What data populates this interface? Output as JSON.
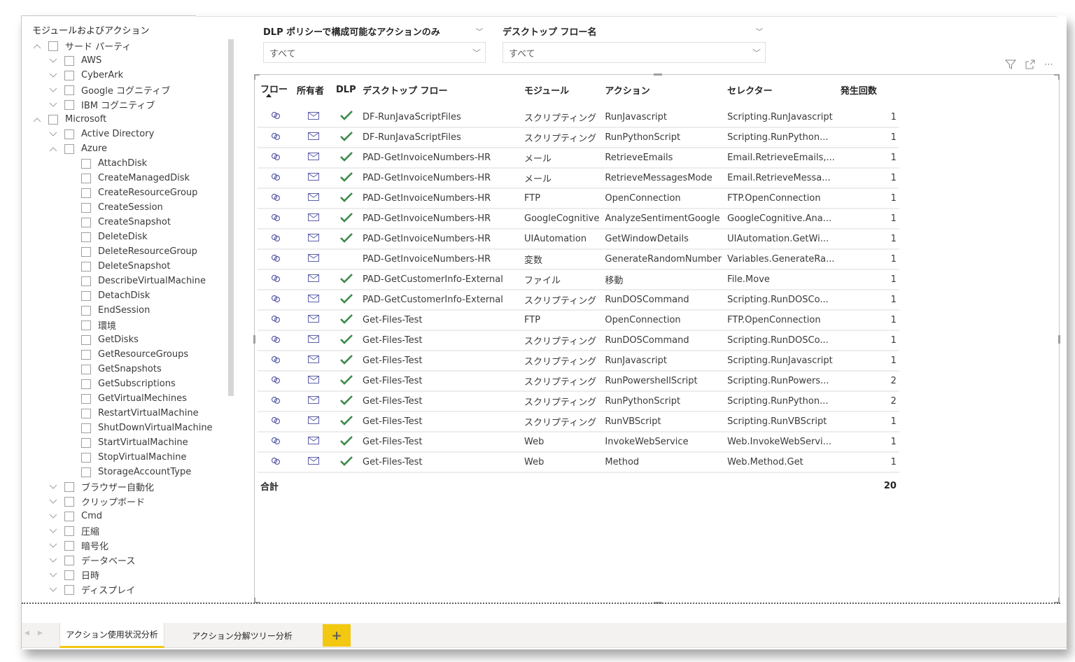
{
  "slicer": {
    "title": "モジュールおよびアクション",
    "items": [
      {
        "label": "サード パーティ",
        "level": 0,
        "expanded": true
      },
      {
        "label": "AWS",
        "level": 1,
        "expanded": false
      },
      {
        "label": "CyberArk",
        "level": 1,
        "expanded": false
      },
      {
        "label": "Google コグニティブ",
        "level": 1,
        "expanded": false
      },
      {
        "label": "IBM コグニティブ",
        "level": 1,
        "expanded": false
      },
      {
        "label": "Microsoft",
        "level": 0,
        "expanded": true
      },
      {
        "label": "Active Directory",
        "level": 1,
        "expanded": false
      },
      {
        "label": "Azure",
        "level": 1,
        "expanded": true
      },
      {
        "label": "AttachDisk",
        "level": 2
      },
      {
        "label": "CreateManagedDisk",
        "level": 2
      },
      {
        "label": "CreateResourceGroup",
        "level": 2
      },
      {
        "label": "CreateSession",
        "level": 2
      },
      {
        "label": "CreateSnapshot",
        "level": 2
      },
      {
        "label": "DeleteDisk",
        "level": 2
      },
      {
        "label": "DeleteResourceGroup",
        "level": 2
      },
      {
        "label": "DeleteSnapshot",
        "level": 2
      },
      {
        "label": "DescribeVirtualMachine",
        "level": 2
      },
      {
        "label": "DetachDisk",
        "level": 2
      },
      {
        "label": "EndSession",
        "level": 2
      },
      {
        "label": "環境",
        "level": 2
      },
      {
        "label": "GetDisks",
        "level": 2
      },
      {
        "label": "GetResourceGroups",
        "level": 2
      },
      {
        "label": "GetSnapshots",
        "level": 2
      },
      {
        "label": "GetSubscriptions",
        "level": 2
      },
      {
        "label": "GetVirtualMechines",
        "level": 2
      },
      {
        "label": "RestartVirtualMachine",
        "level": 2
      },
      {
        "label": "ShutDownVirtualMachine",
        "level": 2
      },
      {
        "label": "StartVirtualMachine",
        "level": 2
      },
      {
        "label": "StopVirtualMachine",
        "level": 2
      },
      {
        "label": "StorageAccountType",
        "level": 2
      },
      {
        "label": "ブラウザー自動化",
        "level": 1,
        "expanded": false
      },
      {
        "label": "クリップボード",
        "level": 1,
        "expanded": false
      },
      {
        "label": "Cmd",
        "level": 1,
        "expanded": false
      },
      {
        "label": "圧縮",
        "level": 1,
        "expanded": false
      },
      {
        "label": "暗号化",
        "level": 1,
        "expanded": false
      },
      {
        "label": "データベース",
        "level": 1,
        "expanded": false
      },
      {
        "label": "日時",
        "level": 1,
        "expanded": false
      },
      {
        "label": "ディスプレイ",
        "level": 1,
        "expanded": false
      }
    ]
  },
  "filters": {
    "dlp": {
      "title": "DLP ポリシーで構成可能なアクションのみ",
      "value": "すべて"
    },
    "flow": {
      "title": "デスクトップ フロー名",
      "value": "すべて"
    }
  },
  "visual_icons": {
    "filter": "filter-icon",
    "focus": "focus-mode-icon",
    "more": "more-options-icon"
  },
  "table": {
    "columns": [
      "フロー",
      "所有者",
      "DLP",
      "デスクトップ フロー",
      "モジュール",
      "アクション",
      "セレクター",
      "発生回数"
    ],
    "sorted_column": "フロー",
    "rows": [
      {
        "dlp": true,
        "flow": "DF-RunJavaScriptFiles",
        "module": "スクリプティング",
        "action": "RunJavascript",
        "selector": "Scripting.RunJavascript",
        "count": "1"
      },
      {
        "dlp": true,
        "flow": "DF-RunJavaScriptFiles",
        "module": "スクリプティング",
        "action": "RunPythonScript",
        "selector": "Scripting.RunPython...",
        "count": "1"
      },
      {
        "dlp": true,
        "flow": "PAD-GetInvoiceNumbers-HR",
        "module": "メール",
        "action": "RetrieveEmails",
        "selector": "Email.RetrieveEmails,...",
        "count": "1"
      },
      {
        "dlp": true,
        "flow": "PAD-GetInvoiceNumbers-HR",
        "module": "メール",
        "action": "RetrieveMessagesMode",
        "selector": "Email.RetrieveMessa...",
        "count": "1"
      },
      {
        "dlp": true,
        "flow": "PAD-GetInvoiceNumbers-HR",
        "module": "FTP",
        "action": "OpenConnection",
        "selector": "FTP.OpenConnection",
        "count": "1"
      },
      {
        "dlp": true,
        "flow": "PAD-GetInvoiceNumbers-HR",
        "module": "GoogleCognitive",
        "action": "AnalyzeSentimentGoogle",
        "selector": "GoogleCognitive.Ana...",
        "count": "1"
      },
      {
        "dlp": true,
        "flow": "PAD-GetInvoiceNumbers-HR",
        "module": "UIAutomation",
        "action": "GetWindowDetails",
        "selector": "UIAutomation.GetWi...",
        "count": "1"
      },
      {
        "dlp": false,
        "flow": "PAD-GetInvoiceNumbers-HR",
        "module": "変数",
        "action": "GenerateRandomNumber",
        "selector": "Variables.GenerateRa...",
        "count": "1"
      },
      {
        "dlp": true,
        "flow": "PAD-GetCustomerInfo-External",
        "module": "ファイル",
        "action": "移動",
        "selector": "File.Move",
        "count": "1"
      },
      {
        "dlp": true,
        "flow": "PAD-GetCustomerInfo-External",
        "module": "スクリプティング",
        "action": "RunDOSCommand",
        "selector": "Scripting.RunDOSCo...",
        "count": "1"
      },
      {
        "dlp": true,
        "flow": "Get-Files-Test",
        "module": "FTP",
        "action": "OpenConnection",
        "selector": "FTP.OpenConnection",
        "count": "1"
      },
      {
        "dlp": true,
        "flow": "Get-Files-Test",
        "module": "スクリプティング",
        "action": "RunDOSCommand",
        "selector": "Scripting.RunDOSCo...",
        "count": "1"
      },
      {
        "dlp": true,
        "flow": "Get-Files-Test",
        "module": "スクリプティング",
        "action": "RunJavascript",
        "selector": "Scripting.RunJavascript",
        "count": "1"
      },
      {
        "dlp": true,
        "flow": "Get-Files-Test",
        "module": "スクリプティング",
        "action": "RunPowershellScript",
        "selector": "Scripting.RunPowers...",
        "count": "2"
      },
      {
        "dlp": true,
        "flow": "Get-Files-Test",
        "module": "スクリプティング",
        "action": "RunPythonScript",
        "selector": "Scripting.RunPython...",
        "count": "2"
      },
      {
        "dlp": true,
        "flow": "Get-Files-Test",
        "module": "スクリプティング",
        "action": "RunVBScript",
        "selector": "Scripting.RunVBScript",
        "count": "1"
      },
      {
        "dlp": true,
        "flow": "Get-Files-Test",
        "module": "Web",
        "action": "InvokeWebService",
        "selector": "Web.InvokeWebServi...",
        "count": "1"
      },
      {
        "dlp": true,
        "flow": "Get-Files-Test",
        "module": "Web",
        "action": "Method",
        "selector": "Web.Method.Get",
        "count": "1"
      }
    ],
    "total_label": "合計",
    "total_value": "20"
  },
  "tabs": {
    "items": [
      "アクション使用状況分析",
      "アクション分解ツリー分析"
    ],
    "active": 0,
    "add_label": "+"
  },
  "colors": {
    "accent": "#f2c811",
    "check": "#3c8a4b",
    "icon": "#5c5fa8"
  }
}
